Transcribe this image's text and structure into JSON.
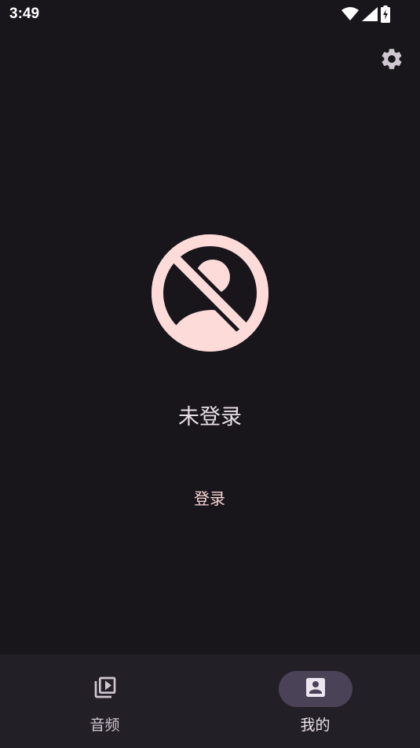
{
  "status_bar": {
    "time": "3:49",
    "icons": [
      "wifi-icon",
      "cellular-signal-icon",
      "battery-charging-icon"
    ]
  },
  "top_actions": {
    "settings_icon": "gear-icon"
  },
  "profile": {
    "avatar_icon": "account-off-icon",
    "status_text": "未登录",
    "login_button_label": "登录"
  },
  "bottom_nav": {
    "items": [
      {
        "label": "音频",
        "icon": "video-library-icon",
        "selected": false
      },
      {
        "label": "我的",
        "icon": "account-box-icon",
        "selected": true
      }
    ]
  },
  "colors": {
    "background": "#18151b",
    "nav_background": "#221f26",
    "nav_active_pill": "#4a4256",
    "accent_pink": "#fad7d7",
    "avatar_fill": "#fddbd9"
  }
}
